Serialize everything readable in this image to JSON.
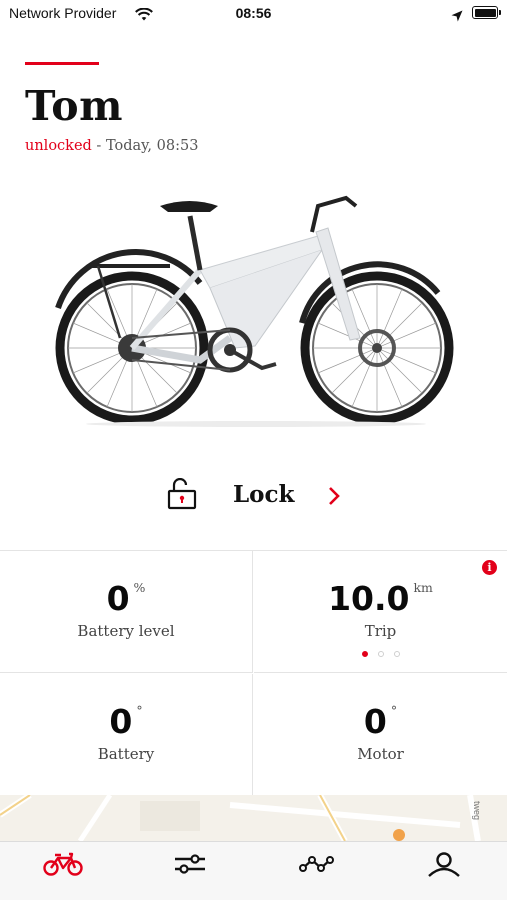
{
  "status_bar": {
    "carrier": "Network Provider",
    "time": "08:56"
  },
  "bike": {
    "name": "Tom",
    "state": "unlocked",
    "state_suffix": " - Today, 08:53"
  },
  "lock_action": {
    "label": "Lock"
  },
  "stats": [
    {
      "value": "0",
      "unit": "%",
      "label": "Battery level"
    },
    {
      "value": "10.0",
      "unit": "km",
      "label": "Trip",
      "pager_count": 3,
      "pager_active": 0
    },
    {
      "value": "0",
      "unit": "°",
      "label": "Battery"
    },
    {
      "value": "0",
      "unit": "°",
      "label": "Motor"
    }
  ],
  "info_badge": "i",
  "map": {
    "road_label": "tweg"
  },
  "tabs": [
    {
      "icon": "bike-icon",
      "active": true
    },
    {
      "icon": "sliders-icon",
      "active": false
    },
    {
      "icon": "route-icon",
      "active": false
    },
    {
      "icon": "profile-icon",
      "active": false
    }
  ],
  "colors": {
    "accent": "#e2001a",
    "text": "#111111",
    "muted": "#555555",
    "divider": "#e4e4e4",
    "tabbar": "#f7f7f7"
  }
}
